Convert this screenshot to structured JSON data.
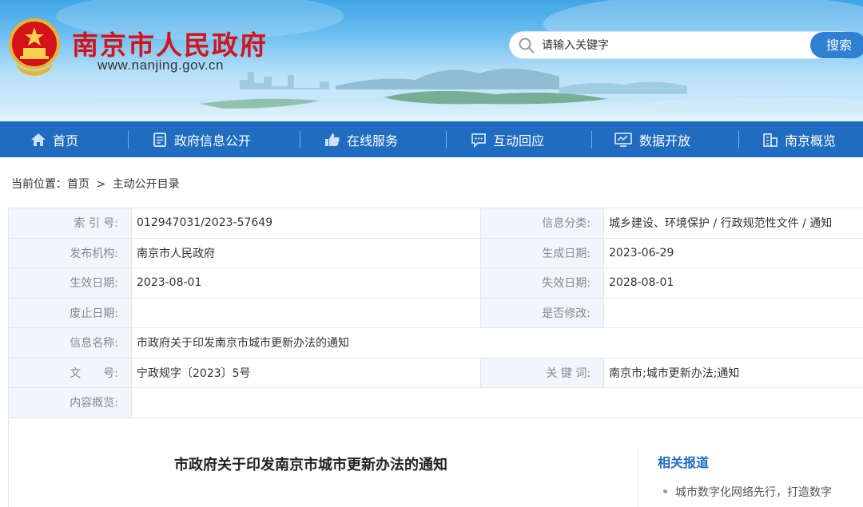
{
  "header": {
    "site_name": "南京市人民政府",
    "site_url": "www.nanjing.gov.cn",
    "search_placeholder": "请输入关键字",
    "search_button": "搜索"
  },
  "nav": {
    "items": [
      {
        "label": "首页",
        "icon": "home-icon"
      },
      {
        "label": "政府信息公开",
        "icon": "document-icon"
      },
      {
        "label": "在线服务",
        "icon": "thumbs-up-icon"
      },
      {
        "label": "互动回应",
        "icon": "chat-icon"
      },
      {
        "label": "数据开放",
        "icon": "monitor-icon"
      },
      {
        "label": "南京概览",
        "icon": "building-icon"
      }
    ]
  },
  "breadcrumb": {
    "prefix": "当前位置：",
    "home": "首页",
    "separator": ">",
    "current": "主动公开目录"
  },
  "info": {
    "index_label": "索 引 号:",
    "index_value": "012947031/2023-57649",
    "category_label": "信息分类:",
    "category_value": "城乡建设、环境保护 / 行政规范性文件 / 通知",
    "publisher_label": "发布机构:",
    "publisher_value": "南京市人民政府",
    "created_label": "生成日期:",
    "created_value": "2023-06-29",
    "effective_label": "生效日期:",
    "effective_value": "2023-08-01",
    "expiry_label": "失效日期:",
    "expiry_value": "2028-08-01",
    "repeal_label": "废止日期:",
    "repeal_value": "",
    "modified_label": "是否修改:",
    "modified_value": "",
    "name_label": "信息名称:",
    "name_value": "市政府关于印发南京市城市更新办法的通知",
    "docno_label": "文　　号:",
    "docno_value": "宁政规字〔2023〕5号",
    "keywords_label": "关 键 词:",
    "keywords_value": "南京市;城市更新办法;通知",
    "summary_label": "内容概览:",
    "summary_value": ""
  },
  "article": {
    "title": "市政府关于印发南京市城市更新办法的通知"
  },
  "related": {
    "title": "相关报道",
    "items": [
      "城市数字化网络先行，打造数字"
    ]
  },
  "colors": {
    "brand_red": "#d4121a",
    "nav_blue": "#1f6cc0",
    "button_blue": "#2f7fd3",
    "label_bg": "#f1f6fb"
  }
}
